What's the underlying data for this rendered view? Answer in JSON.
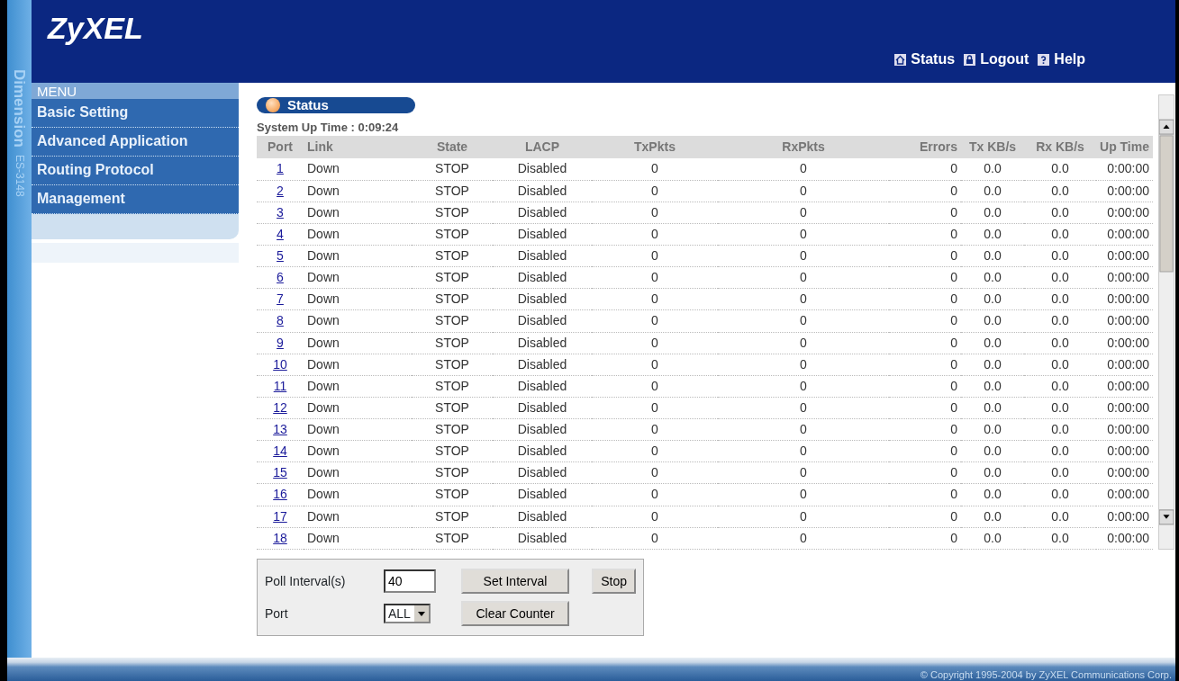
{
  "brand": {
    "logo": "ZyXEL",
    "side_label": "Dimension",
    "model": "ES-3148"
  },
  "header_links": [
    {
      "label": "Status"
    },
    {
      "label": "Logout"
    },
    {
      "label": "Help"
    }
  ],
  "sidebar": {
    "title": "MENU",
    "items": [
      {
        "label": "Basic Setting"
      },
      {
        "label": "Advanced Application"
      },
      {
        "label": "Routing Protocol"
      },
      {
        "label": "Management"
      }
    ]
  },
  "page": {
    "title": "Status",
    "uptime": "System Up Time : 0:09:24"
  },
  "table": {
    "columns": [
      "Port",
      "Link",
      "State",
      "LACP",
      "TxPkts",
      "RxPkts",
      "Errors",
      "Tx KB/s",
      "Rx KB/s",
      "Up Time"
    ],
    "rows": [
      [
        "1",
        "Down",
        "STOP",
        "Disabled",
        "0",
        "0",
        "0",
        "0.0",
        "0.0",
        "0:00:00"
      ],
      [
        "2",
        "Down",
        "STOP",
        "Disabled",
        "0",
        "0",
        "0",
        "0.0",
        "0.0",
        "0:00:00"
      ],
      [
        "3",
        "Down",
        "STOP",
        "Disabled",
        "0",
        "0",
        "0",
        "0.0",
        "0.0",
        "0:00:00"
      ],
      [
        "4",
        "Down",
        "STOP",
        "Disabled",
        "0",
        "0",
        "0",
        "0.0",
        "0.0",
        "0:00:00"
      ],
      [
        "5",
        "Down",
        "STOP",
        "Disabled",
        "0",
        "0",
        "0",
        "0.0",
        "0.0",
        "0:00:00"
      ],
      [
        "6",
        "Down",
        "STOP",
        "Disabled",
        "0",
        "0",
        "0",
        "0.0",
        "0.0",
        "0:00:00"
      ],
      [
        "7",
        "Down",
        "STOP",
        "Disabled",
        "0",
        "0",
        "0",
        "0.0",
        "0.0",
        "0:00:00"
      ],
      [
        "8",
        "Down",
        "STOP",
        "Disabled",
        "0",
        "0",
        "0",
        "0.0",
        "0.0",
        "0:00:00"
      ],
      [
        "9",
        "Down",
        "STOP",
        "Disabled",
        "0",
        "0",
        "0",
        "0.0",
        "0.0",
        "0:00:00"
      ],
      [
        "10",
        "Down",
        "STOP",
        "Disabled",
        "0",
        "0",
        "0",
        "0.0",
        "0.0",
        "0:00:00"
      ],
      [
        "11",
        "Down",
        "STOP",
        "Disabled",
        "0",
        "0",
        "0",
        "0.0",
        "0.0",
        "0:00:00"
      ],
      [
        "12",
        "Down",
        "STOP",
        "Disabled",
        "0",
        "0",
        "0",
        "0.0",
        "0.0",
        "0:00:00"
      ],
      [
        "13",
        "Down",
        "STOP",
        "Disabled",
        "0",
        "0",
        "0",
        "0.0",
        "0.0",
        "0:00:00"
      ],
      [
        "14",
        "Down",
        "STOP",
        "Disabled",
        "0",
        "0",
        "0",
        "0.0",
        "0.0",
        "0:00:00"
      ],
      [
        "15",
        "Down",
        "STOP",
        "Disabled",
        "0",
        "0",
        "0",
        "0.0",
        "0.0",
        "0:00:00"
      ],
      [
        "16",
        "Down",
        "STOP",
        "Disabled",
        "0",
        "0",
        "0",
        "0.0",
        "0.0",
        "0:00:00"
      ],
      [
        "17",
        "Down",
        "STOP",
        "Disabled",
        "0",
        "0",
        "0",
        "0.0",
        "0.0",
        "0:00:00"
      ],
      [
        "18",
        "Down",
        "STOP",
        "Disabled",
        "0",
        "0",
        "0",
        "0.0",
        "0.0",
        "0:00:00"
      ]
    ]
  },
  "controls": {
    "poll_label": "Poll Interval(s)",
    "poll_value": "40",
    "set_button": "Set Interval",
    "stop_button": "Stop",
    "port_label": "Port",
    "port_value": "ALL",
    "clear_button": "Clear Counter"
  },
  "footer": "© Copyright 1995-2004 by ZyXEL Communications Corp."
}
